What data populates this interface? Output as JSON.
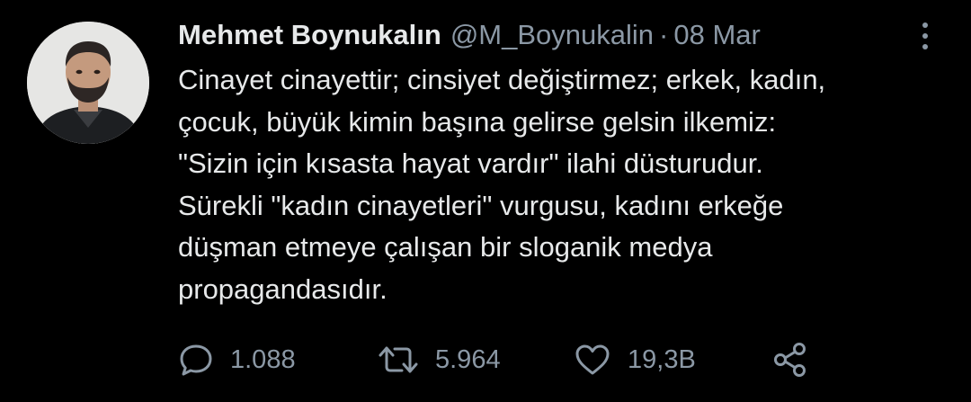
{
  "tweet": {
    "author_name": "Mehmet Boynukalın",
    "author_handle": "@M_Boynukalin",
    "separator": "·",
    "date": "08 Mar",
    "text_lines": [
      "Cinayet cinayettir; cinsiyet değiştirmez; erkek, kadın,",
      "çocuk, büyük kimin başına gelirse gelsin ilkemiz:",
      "\"Sizin için kısasta hayat vardır\" ilahi düsturudur.",
      "Sürekli \"kadın cinayetleri\" vurgusu, kadını erkeğe",
      "düşman etmeye çalışan bir sloganik medya",
      "propagandasıdır."
    ],
    "actions": {
      "reply_count": "1.088",
      "retweet_count": "5.964",
      "like_count": "19,3B"
    }
  },
  "icons": {
    "more": "more-vertical-icon",
    "reply": "reply-bubble-icon",
    "retweet": "retweet-arrows-icon",
    "like": "heart-outline-icon",
    "share": "share-nodes-icon"
  },
  "colors": {
    "background": "#000000",
    "primary_text": "#e7e9ea",
    "secondary_text": "#8b98a5"
  }
}
